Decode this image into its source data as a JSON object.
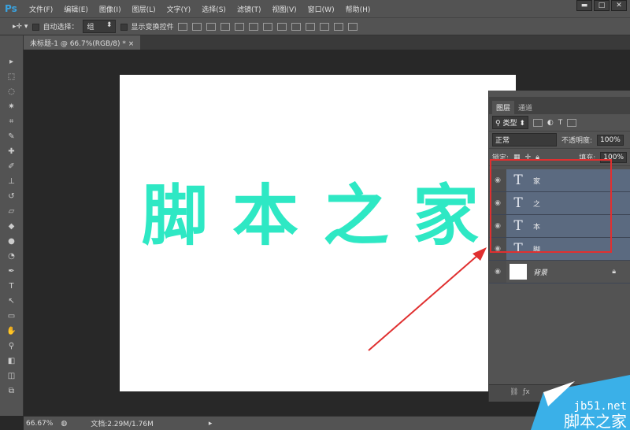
{
  "app": {
    "logo": "Ps",
    "menus": [
      "文件(F)",
      "编辑(E)",
      "图像(I)",
      "图层(L)",
      "文字(Y)",
      "选择(S)",
      "滤镜(T)",
      "视图(V)",
      "窗口(W)",
      "帮助(H)"
    ],
    "window_buttons": [
      "▬",
      "□",
      "✕"
    ]
  },
  "options": {
    "auto_select_label": "自动选择：",
    "auto_select_value": "组",
    "show_transform_label": "显示变换控件"
  },
  "document": {
    "tab_title": "未标题-1 @ 66.7%(RGB/8) *",
    "close": "×",
    "chars": [
      "脚",
      "本",
      "之",
      "家"
    ],
    "text_color": "#2ee8c4"
  },
  "layers_panel": {
    "tabs": [
      "图层",
      "通道"
    ],
    "filter": "类型",
    "blend_mode": "正常",
    "opacity_label": "不透明度:",
    "opacity": "100%",
    "lock_label": "锁定:",
    "fill_label": "填充:",
    "fill": "100%",
    "layers": [
      {
        "name": "家",
        "type": "text"
      },
      {
        "name": "之",
        "type": "text"
      },
      {
        "name": "本",
        "type": "text"
      },
      {
        "name": "脚",
        "type": "text"
      },
      {
        "name": "背景",
        "type": "image",
        "locked": true
      }
    ],
    "selection_color": "#e03030"
  },
  "status": {
    "zoom": "66.67%",
    "doc_size": "文档:2.29M/1.76M"
  },
  "watermark": {
    "site": "jb51.net",
    "name": "脚本之家"
  }
}
